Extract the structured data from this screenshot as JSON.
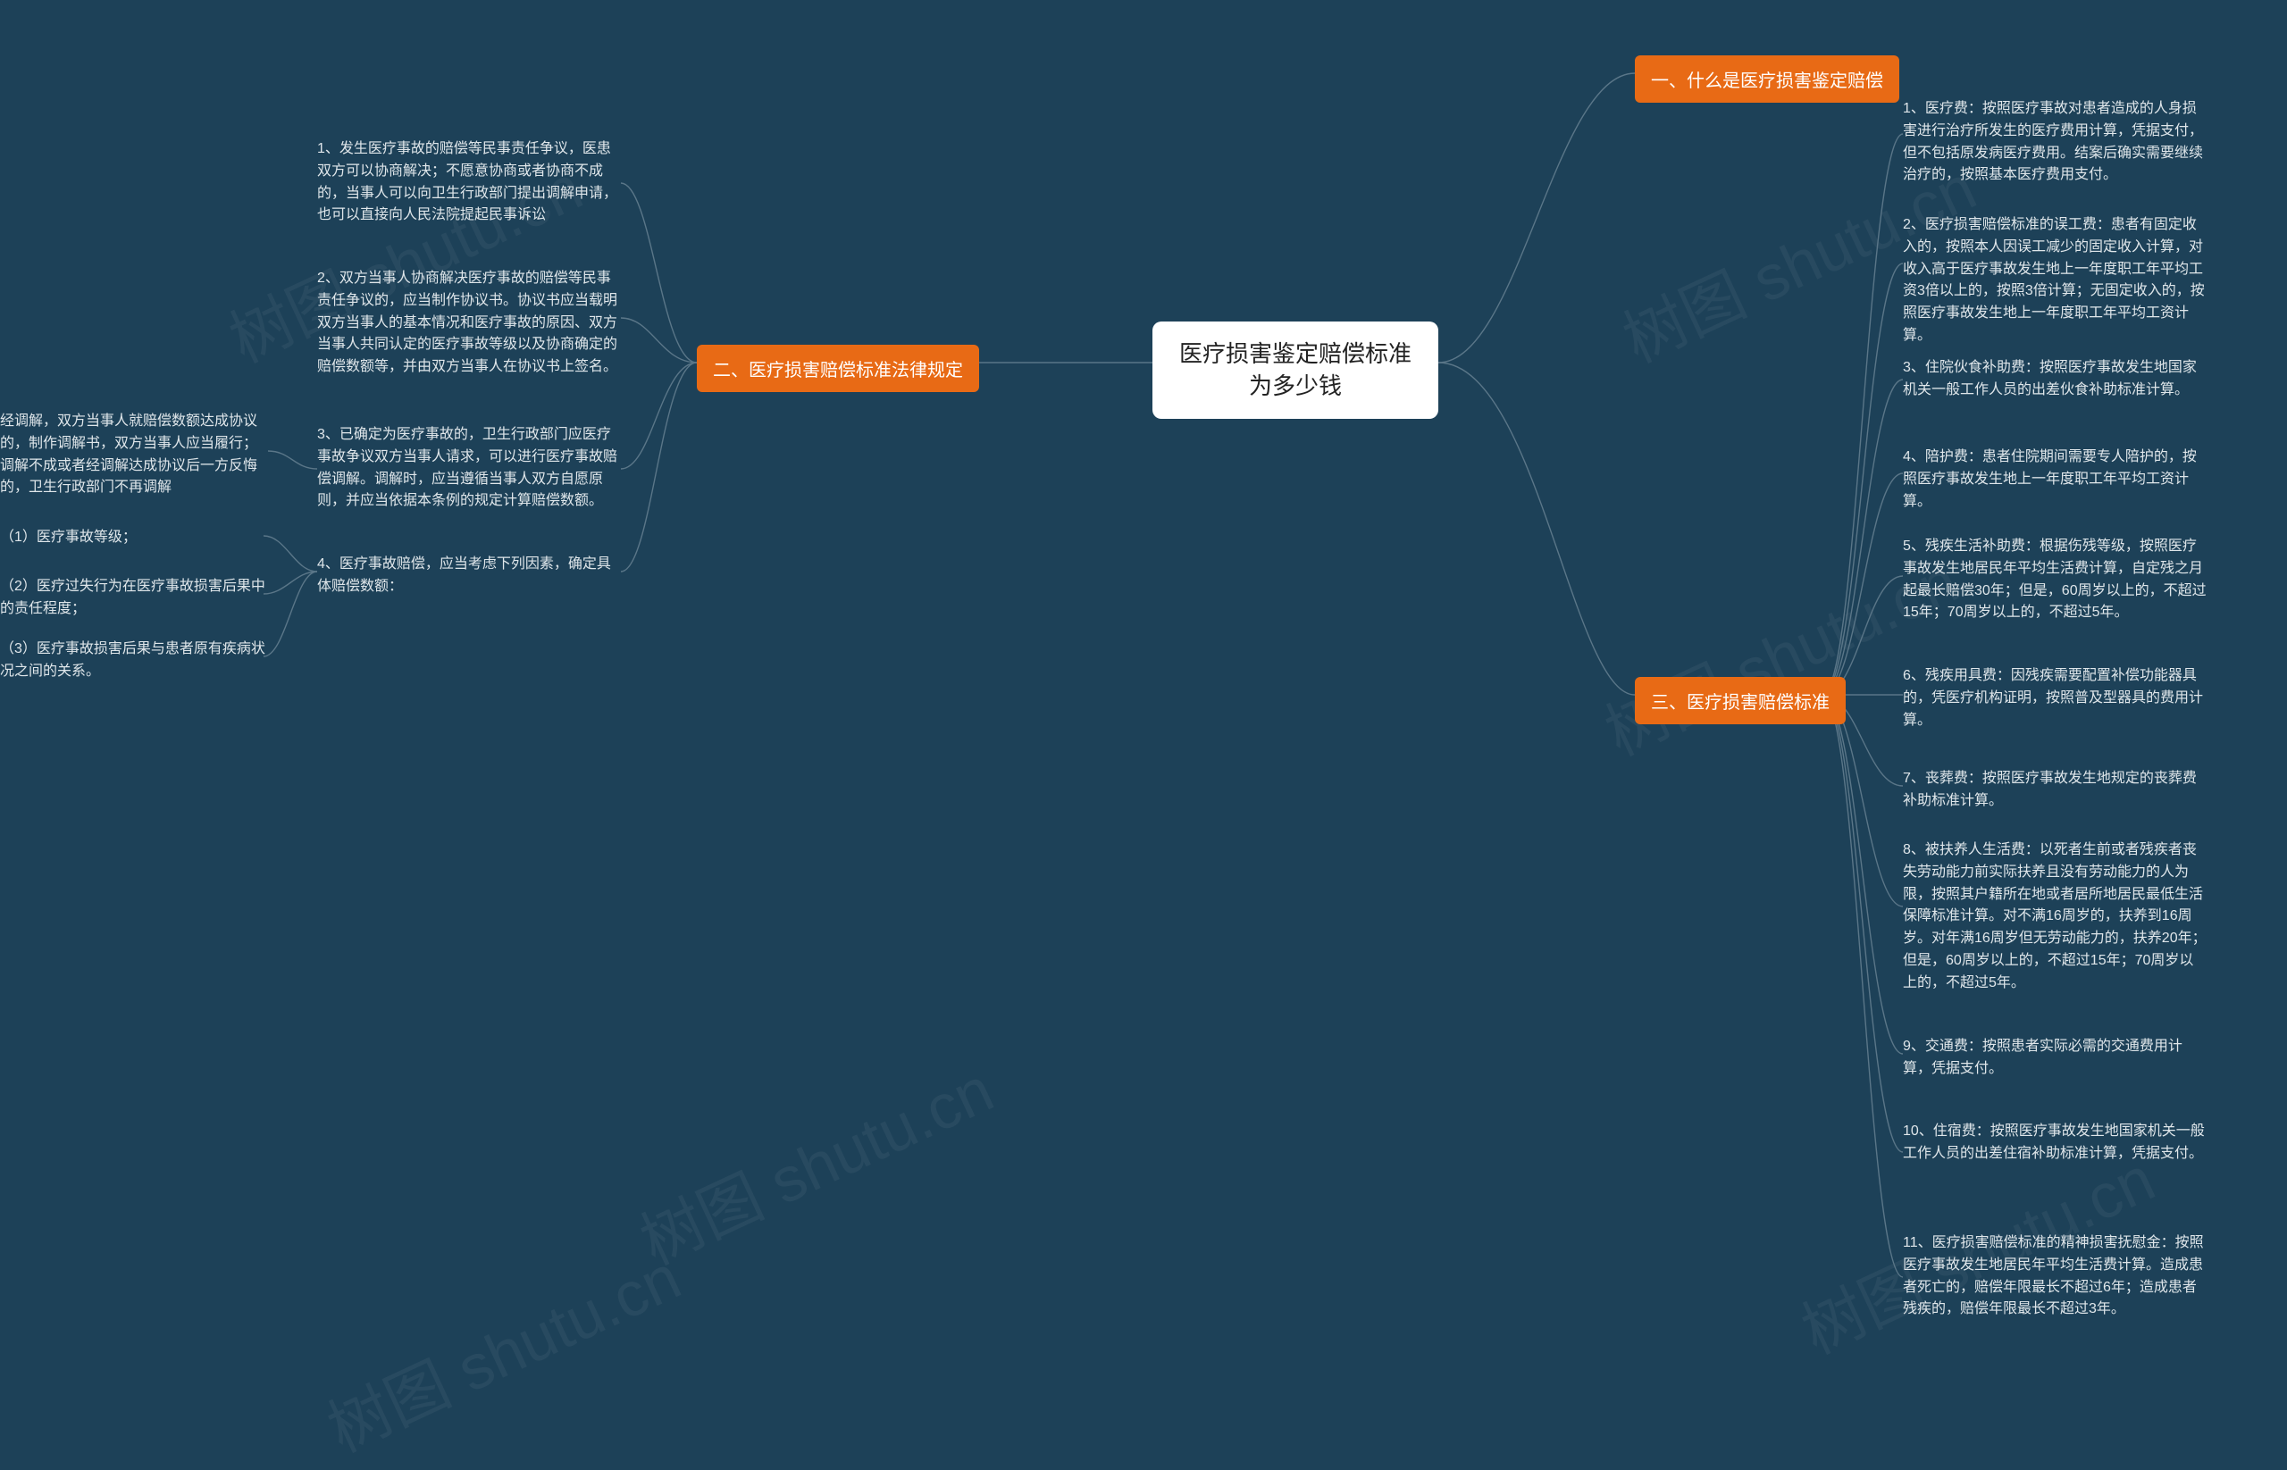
{
  "center": {
    "title": "医疗损害鉴定赔偿标准为多少钱"
  },
  "s1": {
    "title": "一、什么是医疗损害鉴定赔偿"
  },
  "s2": {
    "title": "二、医疗损害赔偿标准法律规定",
    "items": {
      "i1": "1、发生医疗事故的赔偿等民事责任争议，医患双方可以协商解决；不愿意协商或者协商不成的，当事人可以向卫生行政部门提出调解申请，也可以直接向人民法院提起民事诉讼",
      "i2": "2、双方当事人协商解决医疗事故的赔偿等民事责任争议的，应当制作协议书。协议书应当载明双方当事人的基本情况和医疗事故的原因、双方当事人共同认定的医疗事故等级以及协商确定的赔偿数额等，并由双方当事人在协议书上签名。",
      "i3": "3、已确定为医疗事故的，卫生行政部门应医疗事故争议双方当事人请求，可以进行医疗事故赔偿调解。调解时，应当遵循当事人双方自愿原则，并应当依据本条例的规定计算赔偿数额。",
      "i3a": "经调解，双方当事人就赔偿数额达成协议的，制作调解书，双方当事人应当履行；调解不成或者经调解达成协议后一方反悔的，卫生行政部门不再调解",
      "i4": "4、医疗事故赔偿，应当考虑下列因素，确定具体赔偿数额：",
      "i4a": "（1）医疗事故等级；",
      "i4b": "（2）医疗过失行为在医疗事故损害后果中的责任程度；",
      "i4c": "（3）医疗事故损害后果与患者原有疾病状况之间的关系。"
    }
  },
  "s3": {
    "title": "三、医疗损害赔偿标准",
    "items": {
      "i1": "1、医疗费：按照医疗事故对患者造成的人身损害进行治疗所发生的医疗费用计算，凭据支付，但不包括原发病医疗费用。结案后确实需要继续治疗的，按照基本医疗费用支付。",
      "i2": "2、医疗损害赔偿标准的误工费：患者有固定收入的，按照本人因误工减少的固定收入计算，对收入高于医疗事故发生地上一年度职工年平均工资3倍以上的，按照3倍计算；无固定收入的，按照医疗事故发生地上一年度职工年平均工资计算。",
      "i3": "3、住院伙食补助费：按照医疗事故发生地国家机关一般工作人员的出差伙食补助标准计算。",
      "i4": "4、陪护费：患者住院期间需要专人陪护的，按照医疗事故发生地上一年度职工年平均工资计算。",
      "i5": "5、残疾生活补助费：根据伤残等级，按照医疗事故发生地居民年平均生活费计算，自定残之月起最长赔偿30年；但是，60周岁以上的，不超过15年；70周岁以上的，不超过5年。",
      "i6": "6、残疾用具费：因残疾需要配置补偿功能器具的，凭医疗机构证明，按照普及型器具的费用计算。",
      "i7": "7、丧葬费：按照医疗事故发生地规定的丧葬费补助标准计算。",
      "i8": "8、被扶养人生活费：以死者生前或者残疾者丧失劳动能力前实际扶养且没有劳动能力的人为限，按照其户籍所在地或者居所地居民最低生活保障标准计算。对不满16周岁的，扶养到16周岁。对年满16周岁但无劳动能力的，扶养20年；但是，60周岁以上的，不超过15年；70周岁以上的，不超过5年。",
      "i9": "9、交通费：按照患者实际必需的交通费用计算，凭据支付。",
      "i10": "10、住宿费：按照医疗事故发生地国家机关一般工作人员的出差住宿补助标准计算，凭据支付。",
      "i11": "11、医疗损害赔偿标准的精神损害抚慰金：按照医疗事故发生地居民年平均生活费计算。造成患者死亡的，赔偿年限最长不超过6年；造成患者残疾的，赔偿年限最长不超过3年。"
    }
  },
  "watermark": "树图 shutu.cn"
}
